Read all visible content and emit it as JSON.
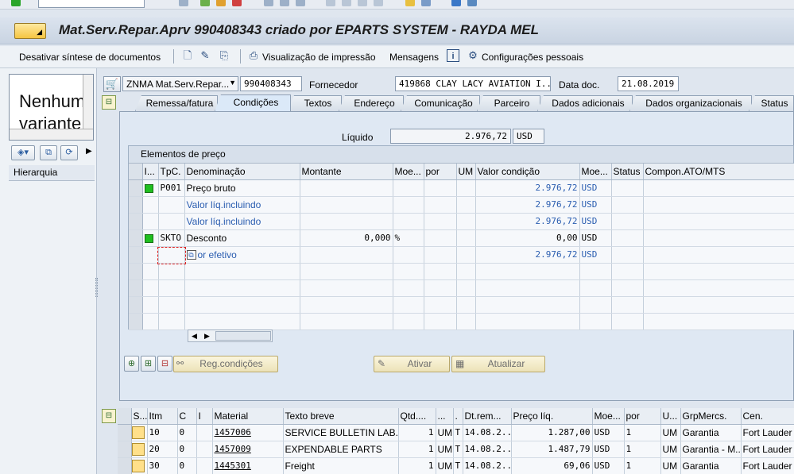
{
  "window": {
    "title": "Mat.Serv.Repar.Aprv 990408343 criado por EPARTS SYSTEM - RAYDA MEL"
  },
  "toolbar": {
    "disable_summary": "Desativar síntese de documentos",
    "print_preview": "Visualização de impressão",
    "messages": "Mensagens",
    "personal_settings": "Configurações pessoais"
  },
  "left_panel": {
    "variant_text": "Nenhum variante",
    "hierarchy_label": "Hierarquia"
  },
  "header": {
    "doc_type": "ZNMA Mat.Serv.Repar...",
    "doc_number": "990408343",
    "vendor_label": "Fornecedor",
    "vendor_value": "419868 CLAY LACY AVIATION I...",
    "doc_date_label": "Data doc.",
    "doc_date_value": "21.08.2019"
  },
  "tabs": [
    {
      "label": "Remessa/fatura",
      "active": false
    },
    {
      "label": "Condições",
      "active": true
    },
    {
      "label": "Textos",
      "active": false
    },
    {
      "label": "Endereço",
      "active": false
    },
    {
      "label": "Comunicação",
      "active": false
    },
    {
      "label": "Parceiro",
      "active": false
    },
    {
      "label": "Dados adicionais",
      "active": false
    },
    {
      "label": "Dados organizacionais",
      "active": false
    },
    {
      "label": "Status",
      "active": false
    }
  ],
  "conditions": {
    "net_label": "Líquido",
    "net_value": "2.976,72",
    "net_currency": "USD",
    "section_title": "Elementos de preço",
    "columns": [
      "I...",
      "TpC.",
      "Denominação",
      "Montante",
      "Moe...",
      "por",
      "UM",
      "Valor condição",
      "Moe...",
      "Status",
      "Compon.ATO/MTS"
    ],
    "rows": [
      {
        "status": "green",
        "type": "P001",
        "name": "Preço bruto",
        "amount": "",
        "amount_cur": "",
        "value": "2.976,72",
        "currency": "USD",
        "blue": false
      },
      {
        "status": "",
        "type": "",
        "name": "Valor líq.incluindo",
        "amount": "",
        "amount_cur": "",
        "value": "2.976,72",
        "currency": "USD",
        "blue": true
      },
      {
        "status": "",
        "type": "",
        "name": "Valor líq.incluindo",
        "amount": "",
        "amount_cur": "",
        "value": "2.976,72",
        "currency": "USD",
        "blue": true
      },
      {
        "status": "green",
        "type": "SKTO",
        "name": "Desconto",
        "amount": "0,000",
        "amount_cur": "%",
        "value": "0,00",
        "currency": "USD",
        "blue": false
      },
      {
        "status": "",
        "type": "",
        "name": "or efetivo",
        "amount": "",
        "amount_cur": "",
        "value": "2.976,72",
        "currency": "USD",
        "blue": true
      }
    ],
    "buttons": {
      "conditions_record": "Reg.condições",
      "activate": "Ativar",
      "update": "Atualizar"
    }
  },
  "items": {
    "columns": [
      "S...",
      "Itm",
      "C",
      "I",
      "Material",
      "Texto breve",
      "Qtd....",
      "...",
      ".",
      "Dt.rem...",
      "Preço líq.",
      "Moe...",
      "por",
      "U...",
      "GrpMercs.",
      "Cen."
    ],
    "rows": [
      {
        "item": "10",
        "c": "0",
        "material": "1457006",
        "text": "SERVICE BULLETIN LAB...",
        "qty": "1",
        "uom": "UM",
        "t": "T",
        "date": "14.08.2...",
        "price": "1.287,00",
        "cur": "USD",
        "per": "1",
        "u": "UM",
        "group": "Garantia",
        "plant": "Fort Lauder"
      },
      {
        "item": "20",
        "c": "0",
        "material": "1457009",
        "text": "EXPENDABLE PARTS",
        "qty": "1",
        "uom": "UM",
        "t": "T",
        "date": "14.08.2...",
        "price": "1.487,79",
        "cur": "USD",
        "per": "1",
        "u": "UM",
        "group": "Garantia - M...",
        "plant": "Fort Lauder"
      },
      {
        "item": "30",
        "c": "0",
        "material": "1445301",
        "text": "Freight",
        "qty": "1",
        "uom": "UM",
        "t": "T",
        "date": "14.08.2...",
        "price": "69,06",
        "cur": "USD",
        "per": "1",
        "u": "UM",
        "group": "Garantia",
        "plant": "Fort Lauder"
      }
    ]
  }
}
